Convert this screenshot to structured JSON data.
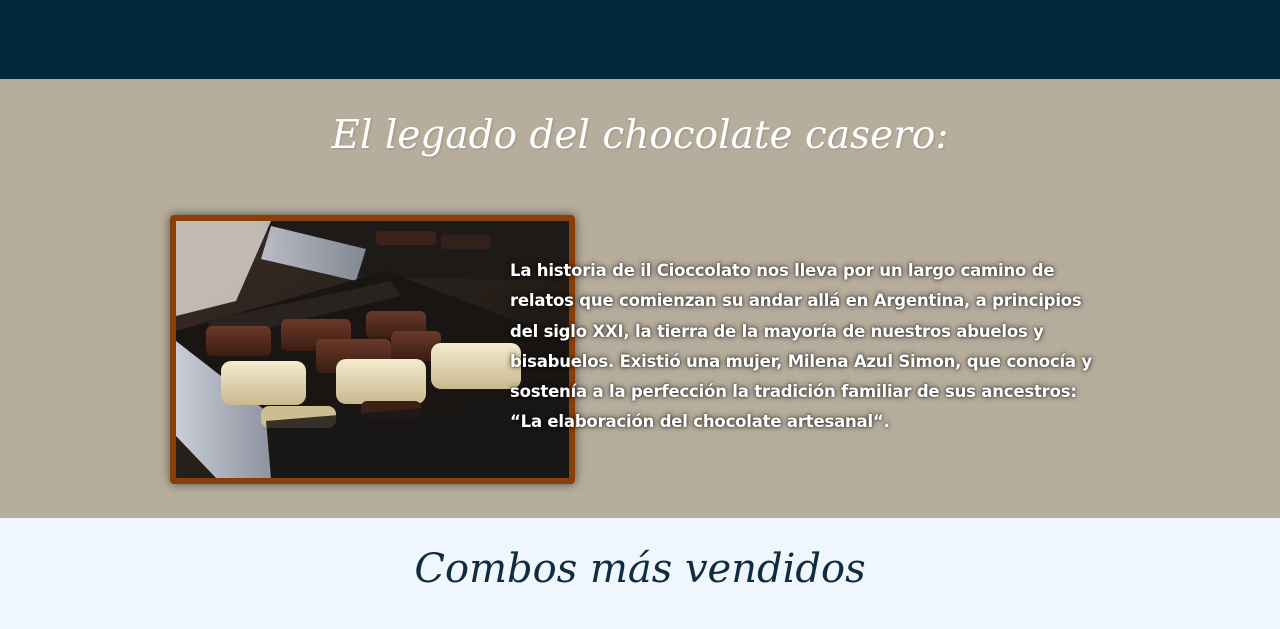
{
  "legacy": {
    "title": "El legado del chocolate casero:",
    "text": "La historia de il Cioccolato nos lleva por un largo camino de relatos que comienzan su andar allá en Argentina, a principios del siglo XXI, la tierra de la mayoría de nuestros abuelos y bisabuelos. Existió una mujer, Milena Azul Simon, que conocía y sostenía a la perfección la tradición familiar de sus ancestros: “La elaboración del chocolate artesanal“."
  },
  "combos": {
    "title": "Combos más vendidos"
  },
  "colors": {
    "header": "#00283c",
    "legacy_bg": "#b6ad9c",
    "combos_bg": "#eff6fd",
    "frame": "#8a3e08",
    "heading_dark": "#0f2c40"
  },
  "images": {
    "chocolates_photo": "box of artisanal chocolate bonbons"
  }
}
